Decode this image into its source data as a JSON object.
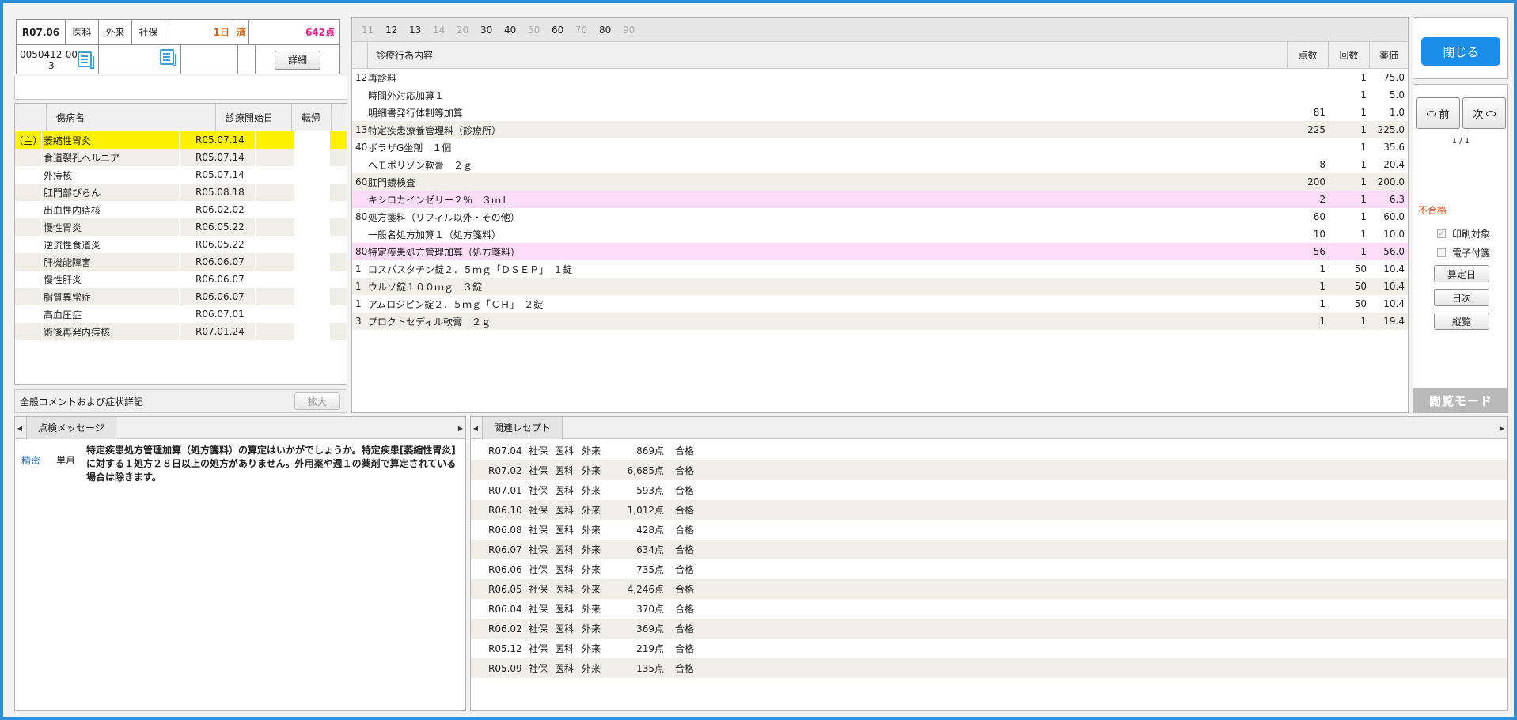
{
  "header": {
    "period": "R07.06",
    "dept": "医科",
    "visit": "外来",
    "insurance": "社保",
    "days": "1日",
    "done": "済",
    "points": "642点",
    "patient_id_1": "0050412-00",
    "patient_id_2": "3",
    "detail_label": "詳細"
  },
  "disease": {
    "columns": [
      "傷病名",
      "診療開始日",
      "転帰"
    ],
    "rows": [
      {
        "mark": "（主）",
        "name": "萎縮性胃炎",
        "date": "R05.07.14",
        "outcome": ""
      },
      {
        "mark": "",
        "name": "食道裂孔ヘルニア",
        "date": "R05.07.14",
        "outcome": ""
      },
      {
        "mark": "",
        "name": "外痔核",
        "date": "R05.07.14",
        "outcome": ""
      },
      {
        "mark": "",
        "name": "肛門部びらん",
        "date": "R05.08.18",
        "outcome": ""
      },
      {
        "mark": "",
        "name": "出血性内痔核",
        "date": "R06.02.02",
        "outcome": ""
      },
      {
        "mark": "",
        "name": "慢性胃炎",
        "date": "R06.05.22",
        "outcome": ""
      },
      {
        "mark": "",
        "name": "逆流性食道炎",
        "date": "R06.05.22",
        "outcome": ""
      },
      {
        "mark": "",
        "name": "肝機能障害",
        "date": "R06.06.07",
        "outcome": ""
      },
      {
        "mark": "",
        "name": "慢性肝炎",
        "date": "R06.06.07",
        "outcome": ""
      },
      {
        "mark": "",
        "name": "脂質異常症",
        "date": "R06.06.07",
        "outcome": ""
      },
      {
        "mark": "",
        "name": "高血圧症",
        "date": "R06.07.01",
        "outcome": ""
      },
      {
        "mark": "",
        "name": "術後再発内痔核",
        "date": "R07.01.24",
        "outcome": ""
      }
    ],
    "comment_label": "全般コメントおよび症状詳記",
    "expand_label": "拡大"
  },
  "treatment": {
    "tabs": [
      {
        "label": "11",
        "enabled": false
      },
      {
        "label": "12",
        "enabled": true
      },
      {
        "label": "13",
        "enabled": true
      },
      {
        "label": "14",
        "enabled": false
      },
      {
        "label": "20",
        "enabled": false
      },
      {
        "label": "30",
        "enabled": true
      },
      {
        "label": "40",
        "enabled": true
      },
      {
        "label": "50",
        "enabled": false
      },
      {
        "label": "60",
        "enabled": true
      },
      {
        "label": "70",
        "enabled": false
      },
      {
        "label": "80",
        "enabled": true
      },
      {
        "label": "90",
        "enabled": false
      }
    ],
    "columns": [
      "診療行為内容",
      "点数",
      "回数",
      "薬価"
    ],
    "rows": [
      {
        "code": "12",
        "name": "再診料",
        "points": "",
        "count": "1",
        "price": "75.0",
        "style": ""
      },
      {
        "code": "",
        "name": "時間外対応加算１",
        "points": "",
        "count": "1",
        "price": "5.0",
        "style": ""
      },
      {
        "code": "",
        "name": "明細書発行体制等加算",
        "points": "81",
        "count": "1",
        "price": "1.0",
        "style": ""
      },
      {
        "code": "13",
        "name": "特定疾患療養管理料（診療所）",
        "points": "225",
        "count": "1",
        "price": "225.0",
        "style": "alt"
      },
      {
        "code": "40",
        "name": "ボラザG坐剤　１個",
        "points": "",
        "count": "1",
        "price": "35.6",
        "style": ""
      },
      {
        "code": "",
        "name": "ヘモポリゾン軟膏　２ｇ",
        "points": "8",
        "count": "1",
        "price": "20.4",
        "style": ""
      },
      {
        "code": "60",
        "name": "肛門鏡検査",
        "points": "200",
        "count": "1",
        "price": "200.0",
        "style": "alt"
      },
      {
        "code": "",
        "name": "キシロカインゼリー２％　３ｍＬ",
        "points": "2",
        "count": "1",
        "price": "6.3",
        "style": "pink"
      },
      {
        "code": "80",
        "name": "処方箋料（リフィル以外・その他）",
        "points": "60",
        "count": "1",
        "price": "60.0",
        "style": ""
      },
      {
        "code": "",
        "name": "一般名処方加算１（処方箋料）",
        "points": "10",
        "count": "1",
        "price": "10.0",
        "style": ""
      },
      {
        "code": "80",
        "name": "特定疾患処方管理加算（処方箋料）",
        "points": "56",
        "count": "1",
        "price": "56.0",
        "style": "pink"
      },
      {
        "code": "1",
        "name": "ロスバスタチン錠２．５ｍｇ「ＤＳＥＰ」　１錠",
        "points": "1",
        "count": "50",
        "price": "10.4",
        "style": ""
      },
      {
        "code": "1",
        "name": "ウルソ錠１００ｍｇ　３錠",
        "points": "1",
        "count": "50",
        "price": "10.4",
        "style": "alt"
      },
      {
        "code": "1",
        "name": "アムロジピン錠２．５ｍｇ「ＣＨ」　２錠",
        "points": "1",
        "count": "50",
        "price": "10.4",
        "style": ""
      },
      {
        "code": "3",
        "name": "プロクトセディル軟膏　２ｇ",
        "points": "1",
        "count": "1",
        "price": "19.4",
        "style": "alt"
      }
    ]
  },
  "side": {
    "close_label": "閉じる",
    "prev_label": "前",
    "next_label": "次",
    "page": "1 / 1",
    "status": "不合格",
    "print_label": "印刷対象",
    "print_checked": true,
    "attach_label": "電子付箋",
    "attach_checked": false,
    "calc_day_label": "算定日",
    "daily_label": "日次",
    "vertical_label": "縦覧",
    "mode_label": "閲覧モード"
  },
  "messages": {
    "tab_label": "点検メッセージ",
    "items": [
      {
        "level": "精密",
        "scope": "単月",
        "text": "特定疾患処方管理加算（処方箋料）の算定はいかがでしょうか。特定疾患[萎縮性胃炎]に対する１処方２８日以上の処方がありません。外用薬や週１の薬剤で算定されている場合は除きます。"
      }
    ]
  },
  "related": {
    "tab_label": "関連レセプト",
    "rows": [
      {
        "period": "R07.04",
        "ins": "社保",
        "dept": "医科",
        "visit": "外来",
        "points": "869点",
        "result": "合格"
      },
      {
        "period": "R07.02",
        "ins": "社保",
        "dept": "医科",
        "visit": "外来",
        "points": "6,685点",
        "result": "合格"
      },
      {
        "period": "R07.01",
        "ins": "社保",
        "dept": "医科",
        "visit": "外来",
        "points": "593点",
        "result": "合格"
      },
      {
        "period": "R06.10",
        "ins": "社保",
        "dept": "医科",
        "visit": "外来",
        "points": "1,012点",
        "result": "合格"
      },
      {
        "period": "R06.08",
        "ins": "社保",
        "dept": "医科",
        "visit": "外来",
        "points": "428点",
        "result": "合格"
      },
      {
        "period": "R06.07",
        "ins": "社保",
        "dept": "医科",
        "visit": "外来",
        "points": "634点",
        "result": "合格"
      },
      {
        "period": "R06.06",
        "ins": "社保",
        "dept": "医科",
        "visit": "外来",
        "points": "735点",
        "result": "合格"
      },
      {
        "period": "R06.05",
        "ins": "社保",
        "dept": "医科",
        "visit": "外来",
        "points": "4,246点",
        "result": "合格"
      },
      {
        "period": "R06.04",
        "ins": "社保",
        "dept": "医科",
        "visit": "外来",
        "points": "370点",
        "result": "合格"
      },
      {
        "period": "R06.02",
        "ins": "社保",
        "dept": "医科",
        "visit": "外来",
        "points": "369点",
        "result": "合格"
      },
      {
        "period": "R05.12",
        "ins": "社保",
        "dept": "医科",
        "visit": "外来",
        "points": "219点",
        "result": "合格"
      },
      {
        "period": "R05.09",
        "ins": "社保",
        "dept": "医科",
        "visit": "外来",
        "points": "135点",
        "result": "合格"
      }
    ]
  },
  "colors": {
    "frame": "#2d8fd9",
    "main_disease_bg": "#fff200",
    "pink_row": "#fcdcf7",
    "alt_row": "#efefe7",
    "close_button": "#1a8ee8",
    "fail_text": "#e0470a"
  }
}
